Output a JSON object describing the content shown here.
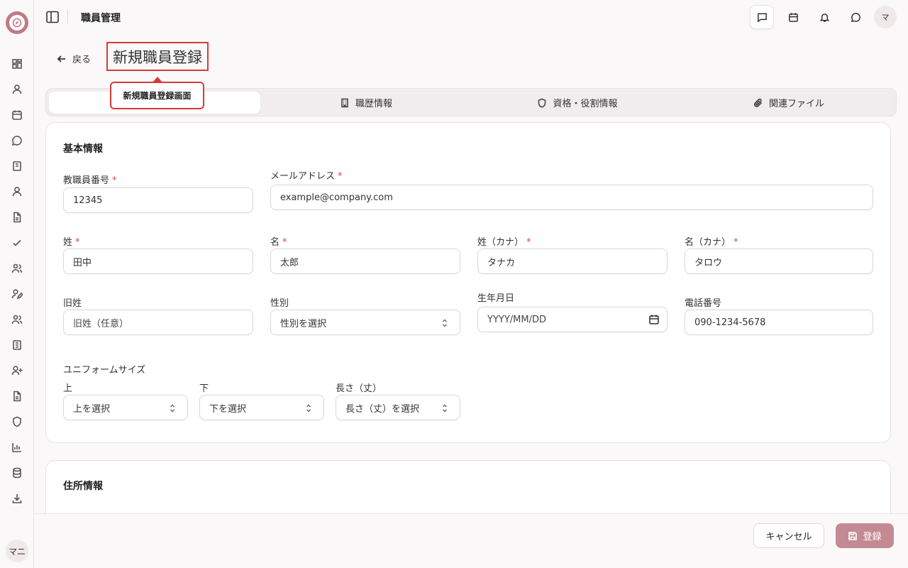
{
  "app": {
    "section_title": "職員管理",
    "user_initials": "マ",
    "rail_user_initials": "マニ"
  },
  "rail": {
    "icons": [
      "dashboard-icon",
      "user-icon",
      "calendar-icon",
      "chat-icon",
      "book-icon",
      "user-icon",
      "document-icon",
      "check-icon",
      "users-icon",
      "user-edit-icon",
      "users-icon",
      "book-icon",
      "user-plus-icon",
      "document-icon",
      "shield-icon",
      "bar-chart-icon",
      "database-icon",
      "download-icon"
    ]
  },
  "header": {
    "back_label": "戻る",
    "page_title": "新規職員登録",
    "tooltip": "新規職員登録画面"
  },
  "tabs": [
    {
      "label": "",
      "icon": "",
      "active": true
    },
    {
      "label": "職歴情報",
      "icon": "building-icon"
    },
    {
      "label": "資格・役割情報",
      "icon": "shield-icon"
    },
    {
      "label": "関連ファイル",
      "icon": "paperclip-icon"
    }
  ],
  "basic": {
    "title": "基本情報",
    "employee_no": {
      "label": "教職員番号",
      "value": "12345",
      "required": "*"
    },
    "email": {
      "label": "メールアドレス",
      "value": "example@company.com",
      "required": "*"
    },
    "last_name": {
      "label": "姓",
      "value": "田中",
      "required": "*"
    },
    "first_name": {
      "label": "名",
      "value": "太郎",
      "required": "*"
    },
    "last_kana": {
      "label": "姓（カナ）",
      "value": "タナカ",
      "required": "*"
    },
    "first_kana": {
      "label": "名（カナ）",
      "value": "タロウ",
      "required": "*"
    },
    "old_name": {
      "label": "旧姓",
      "placeholder": "旧姓（任意）"
    },
    "gender": {
      "label": "性別",
      "placeholder": "性別を選択"
    },
    "birthday": {
      "label": "生年月日",
      "placeholder": "YYYY/MM/DD"
    },
    "phone": {
      "label": "電話番号",
      "value": "090-1234-5678"
    },
    "uniform": {
      "title": "ユニフォームサイズ",
      "top": {
        "label": "上",
        "placeholder": "上を選択"
      },
      "bottom": {
        "label": "下",
        "placeholder": "下を選択"
      },
      "length": {
        "label": "長さ（丈）",
        "placeholder": "長さ（丈）を選択"
      }
    }
  },
  "address": {
    "title": "住所情報"
  },
  "footer": {
    "cancel_label": "キャンセル",
    "save_label": "登録"
  },
  "colors": {
    "accent": "#c48a93",
    "highlight": "#d63b3b",
    "required": "#d64545"
  }
}
